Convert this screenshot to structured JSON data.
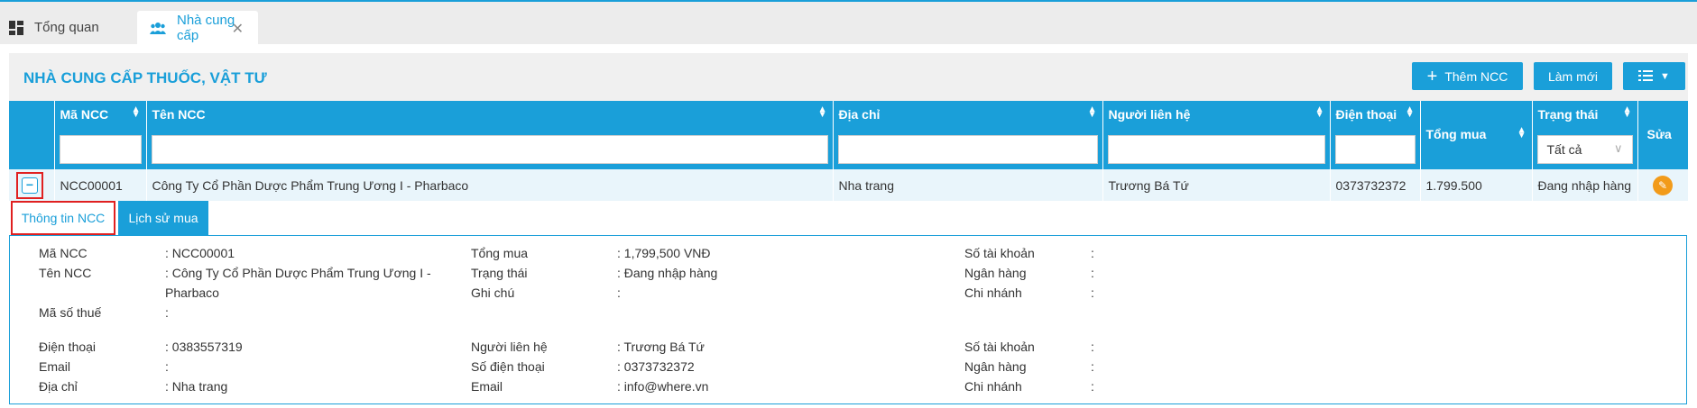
{
  "tabs": [
    {
      "label": "Tổng quan",
      "icon": "dashboard-icon"
    },
    {
      "label": "Nhà cung cấp",
      "icon": "users-icon"
    }
  ],
  "panel": {
    "title": "NHÀ CUNG CẤP THUỐC, VẬT TƯ",
    "buttons": {
      "add": "Thêm NCC",
      "refresh": "Làm mới",
      "columns_icon": "list-icon"
    }
  },
  "table": {
    "headers": {
      "code": "Mã NCC",
      "name": "Tên NCC",
      "address": "Địa chỉ",
      "contact": "Người liên hệ",
      "phone": "Điện thoại",
      "total": "Tổng mua",
      "status": "Trạng thái",
      "edit": "Sửa"
    },
    "status_filter": "Tất cả",
    "rows": [
      {
        "code": "NCC00001",
        "name": "Công Ty Cổ Phần Dược Phẩm Trung Ương I - Pharbaco",
        "address": "Nha trang",
        "contact": "Trương Bá Tứ",
        "phone": "0373732372",
        "total": "1.799.500",
        "status": "Đang nhập hàng"
      }
    ]
  },
  "detail": {
    "tabs": {
      "info": "Thông tin NCC",
      "history": "Lịch sử mua"
    },
    "col1": [
      {
        "label": "Mã NCC",
        "value": ": NCC00001"
      },
      {
        "label": "Tên NCC",
        "value": ": Công Ty Cổ Phần Dược Phẩm Trung Ương I -",
        "value2": "Pharbaco"
      },
      {
        "label": "Mã số thuế",
        "value": ":"
      },
      {
        "label": "Điện thoại",
        "value": ": 0383557319"
      },
      {
        "label": "Email",
        "value": ":"
      },
      {
        "label": "Địa chỉ",
        "value": ": Nha trang"
      }
    ],
    "col2": [
      {
        "label": "Tổng mua",
        "value": ": 1,799,500 VNĐ"
      },
      {
        "label": "Trạng thái",
        "value": ": Đang nhập hàng"
      },
      {
        "label": "Ghi chú",
        "value": ":"
      },
      {
        "label": "Người liên hệ",
        "value": ": Trương Bá Tứ"
      },
      {
        "label": "Số điện thoại",
        "value": ": 0373732372"
      },
      {
        "label": "Email",
        "value": ": info@where.vn"
      }
    ],
    "col3": [
      {
        "label": "Số tài khoản",
        "value": ":"
      },
      {
        "label": "Ngân hàng",
        "value": ":"
      },
      {
        "label": "Chi nhánh",
        "value": ":"
      },
      {
        "label": "Số tài khoản",
        "value": ":"
      },
      {
        "label": "Ngân hàng",
        "value": ":"
      },
      {
        "label": "Chi nhánh",
        "value": ":"
      }
    ]
  },
  "colors": {
    "accent": "#1a9fd9",
    "highlight": "#e02020",
    "edit": "#f29b1a"
  }
}
